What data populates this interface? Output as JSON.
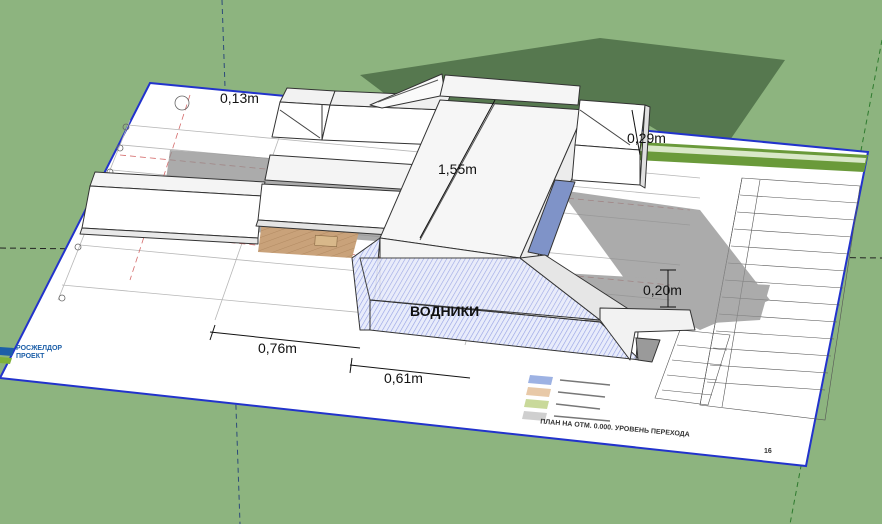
{
  "viewport": {
    "background_color": "#8db47f",
    "shadow_color": "#56784f",
    "sheet_color": "#ffffff",
    "sheet_border_color": "#2233cc",
    "sheet_accent_color": "#6a9a3a",
    "glass_color": "#7f93c8",
    "floor_color": "#c9a27a"
  },
  "dimensions": {
    "top_left": "0,13m",
    "length": "1,55m",
    "right_top": "0,29m",
    "height": "0,20m",
    "width_left": "0,76m",
    "width_mid": "0,61m"
  },
  "building_label": "ВОДНИКИ",
  "sheet": {
    "logo_line1": "РОСЖЕЛДОР",
    "logo_line2": "ПРОЕКТ",
    "caption": "ПЛАН НА ОТМ. 0.000. УРОВЕНЬ ПЕРЕХОДА",
    "page_number": "16"
  }
}
